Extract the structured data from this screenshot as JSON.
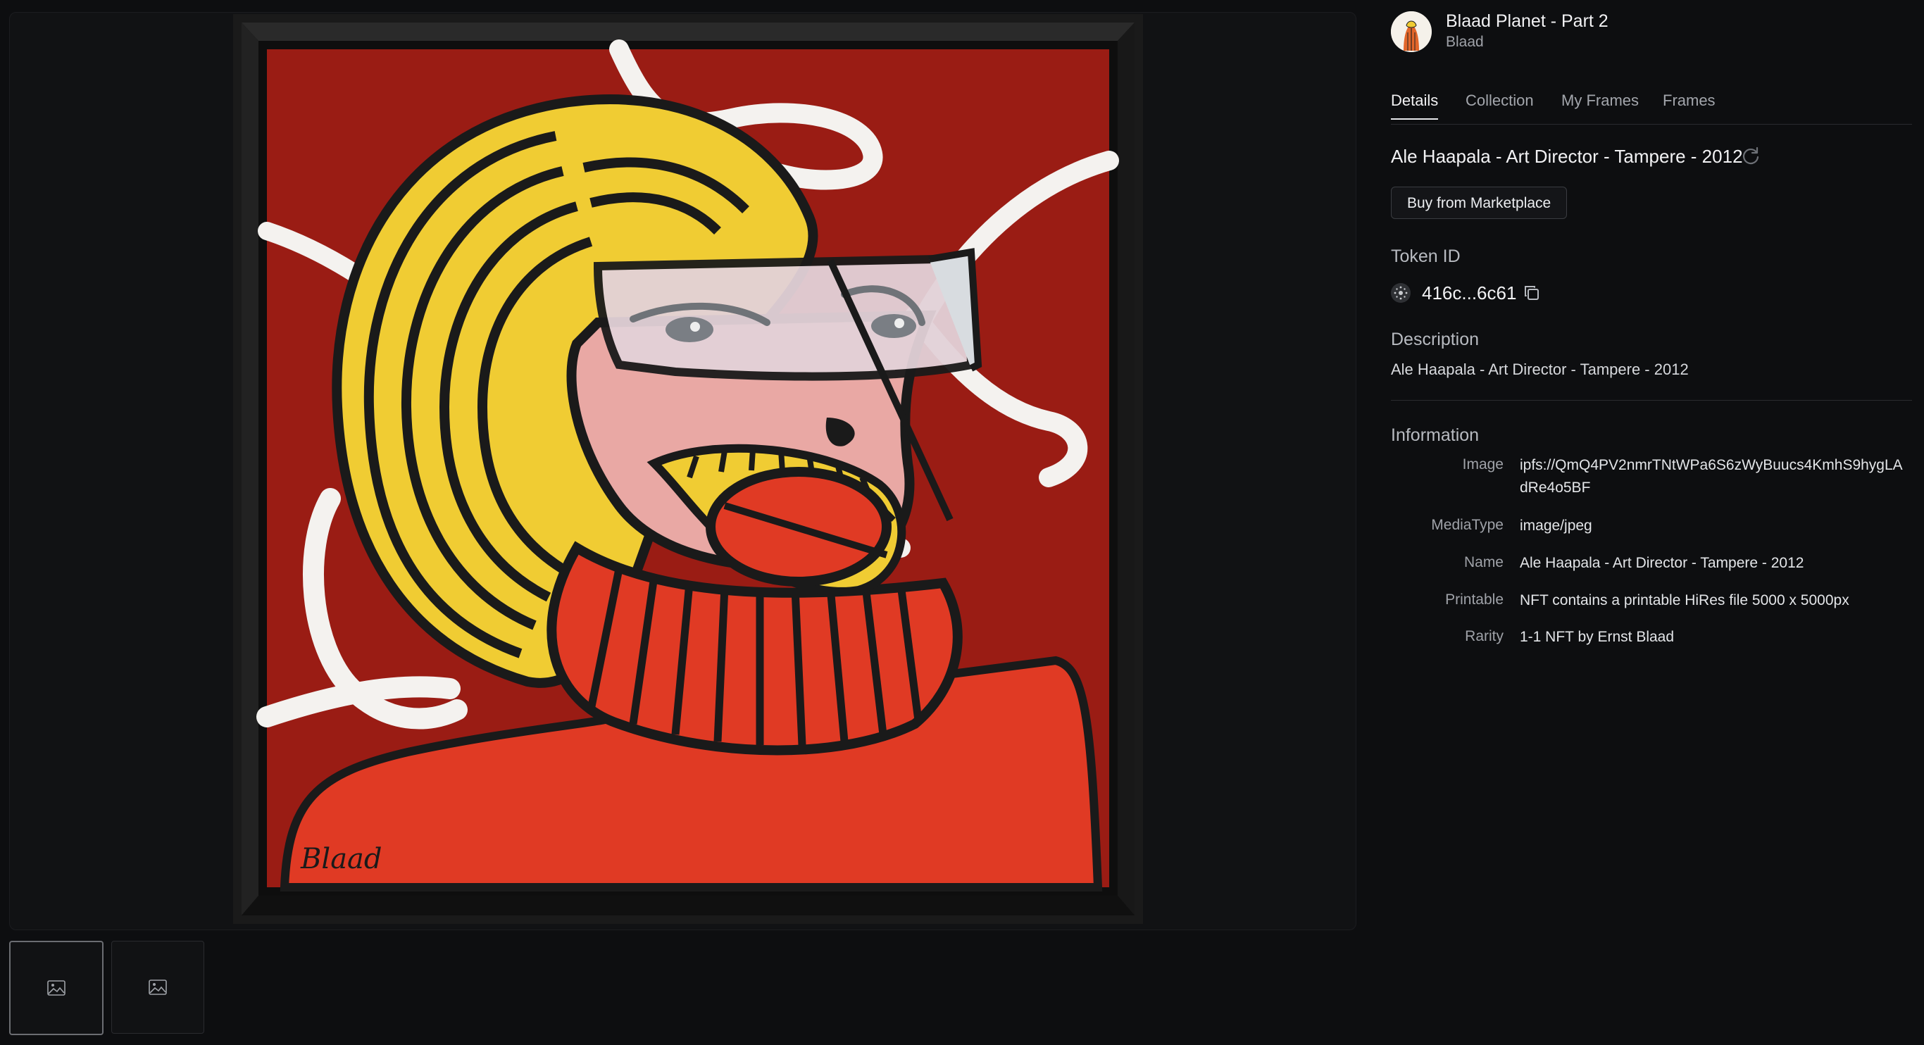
{
  "item": {
    "collection_title": "Blaad Planet - Part 2",
    "creator": "Blaad",
    "title": "Ale Haapala - Art Director - Tampere - 2012"
  },
  "tabs": [
    {
      "label": "Details",
      "active": true
    },
    {
      "label": "Collection",
      "active": false
    },
    {
      "label": "My Frames",
      "active": false
    },
    {
      "label": "Frames",
      "active": false
    }
  ],
  "actions": {
    "buy_label": "Buy from Marketplace"
  },
  "token": {
    "label": "Token ID",
    "id": "416c...6c61"
  },
  "description": {
    "label": "Description",
    "text": "Ale Haapala - Art Director - Tampere - 2012"
  },
  "information": {
    "label": "Information",
    "rows": [
      {
        "key": "Image",
        "value": "ipfs://QmQ4PV2nmrTNtWPa6S6zWyBuucs4KmhS9hygLAdRe4o5BF"
      },
      {
        "key": "MediaType",
        "value": "image/jpeg"
      },
      {
        "key": "Name",
        "value": "Ale Haapala - Art Director - Tampere - 2012"
      },
      {
        "key": "Printable",
        "value": "NFT contains a printable HiRes file 5000 x 5000px"
      },
      {
        "key": "Rarity",
        "value": "1-1 NFT by Ernst Blaad"
      }
    ]
  },
  "artwork": {
    "signature": "Blaad",
    "colors": {
      "background": "#9a1c14",
      "sweater": "#e03a24",
      "hair": "#f0cc33",
      "face": "#e9a8a4",
      "visor": "#e3d2d8",
      "frame": "#141414"
    }
  },
  "thumbnails": [
    {
      "icon": "image-icon",
      "active": true
    },
    {
      "icon": "image-icon",
      "active": false
    }
  ]
}
